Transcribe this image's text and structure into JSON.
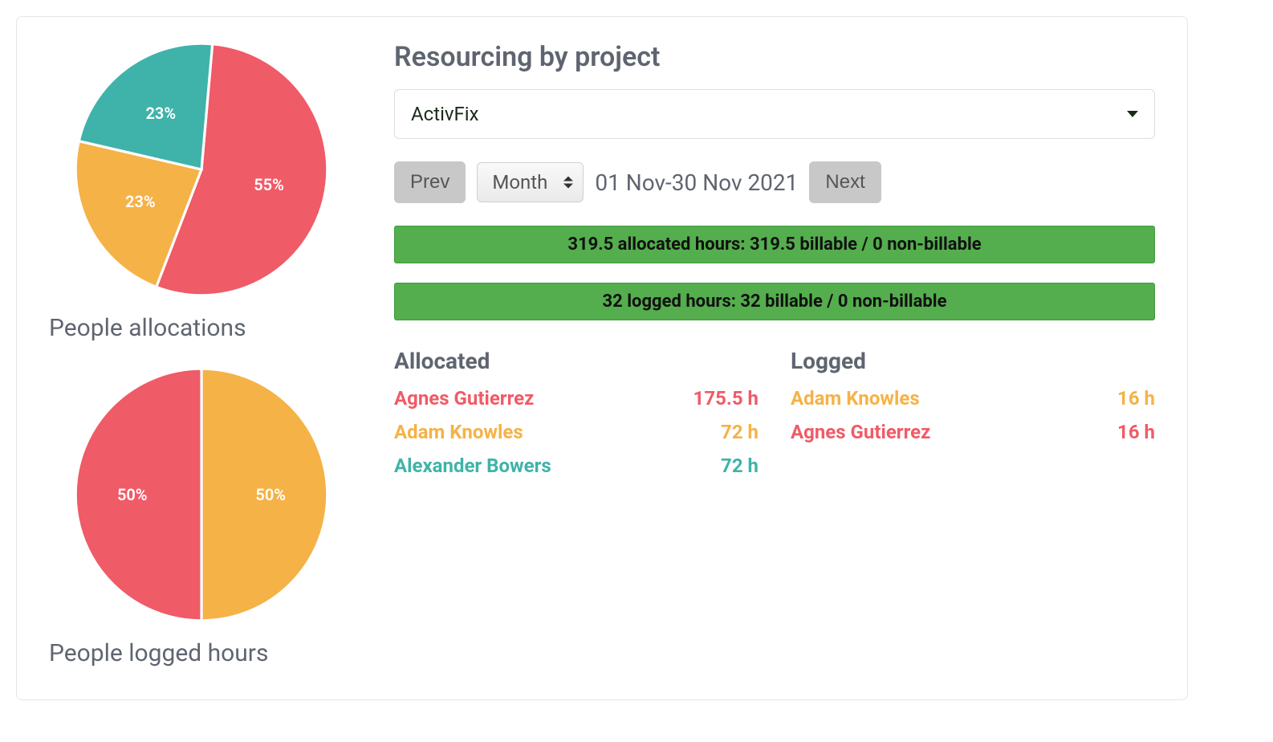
{
  "colors": {
    "red": "#ef5b67",
    "orange": "#f5b247",
    "teal": "#3fb3a9",
    "green_bar": "#54ae4d"
  },
  "chart_data": [
    {
      "type": "pie",
      "title": "People allocations",
      "series": [
        {
          "name": "Agnes Gutierrez",
          "value": 55,
          "label": "55%",
          "color": "#ef5b67"
        },
        {
          "name": "Adam Knowles",
          "value": 23,
          "label": "23%",
          "color": "#f5b247"
        },
        {
          "name": "Alexander Bowers",
          "value": 23,
          "label": "23%",
          "color": "#3fb3a9"
        }
      ]
    },
    {
      "type": "pie",
      "title": "People logged hours",
      "series": [
        {
          "name": "Adam Knowles",
          "value": 50,
          "label": "50%",
          "color": "#f5b247"
        },
        {
          "name": "Agnes Gutierrez",
          "value": 50,
          "label": "50%",
          "color": "#ef5b67"
        }
      ]
    }
  ],
  "right": {
    "title": "Resourcing by project",
    "project": "ActivFix",
    "prev_label": "Prev",
    "next_label": "Next",
    "period_label": "Month",
    "date_range": "01 Nov-30 Nov 2021",
    "allocated_bar": "319.5 allocated hours: 319.5 billable / 0 non-billable",
    "logged_bar": "32 logged hours: 32 billable / 0 non-billable",
    "allocated_heading": "Allocated",
    "logged_heading": "Logged",
    "allocated_rows": [
      {
        "name": "Agnes Gutierrez",
        "hours": "175.5 h",
        "color": "#ef5b67"
      },
      {
        "name": "Adam Knowles",
        "hours": "72 h",
        "color": "#f5b247"
      },
      {
        "name": "Alexander Bowers",
        "hours": "72 h",
        "color": "#3fb3a9"
      }
    ],
    "logged_rows": [
      {
        "name": "Adam Knowles",
        "hours": "16 h",
        "color": "#f5b247"
      },
      {
        "name": "Agnes Gutierrez",
        "hours": "16 h",
        "color": "#ef5b67"
      }
    ]
  }
}
